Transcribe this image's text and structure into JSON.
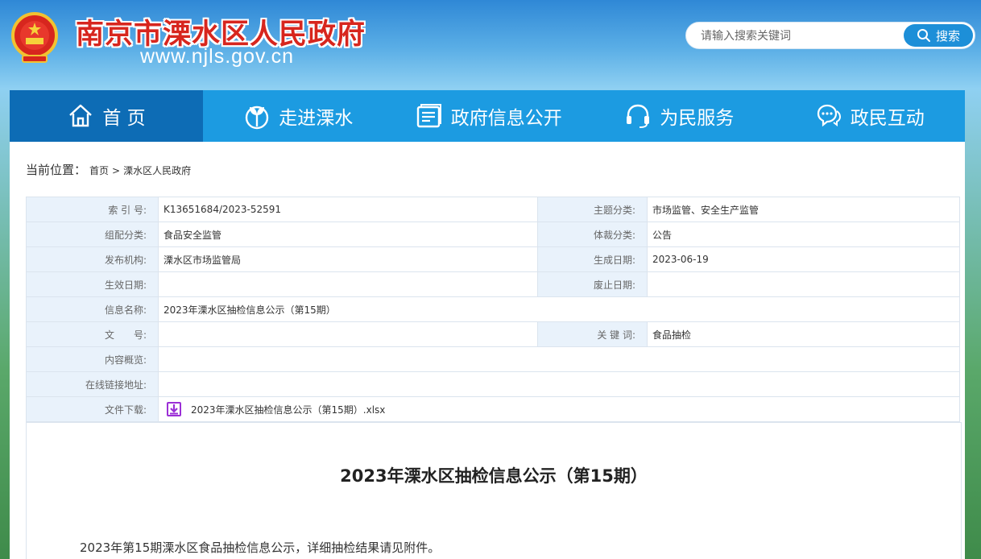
{
  "header": {
    "site_title": "南京市溧水区人民政府",
    "site_url": "www.njls.gov.cn",
    "search_placeholder": "请输入搜索关键词",
    "search_button": "搜索"
  },
  "nav": {
    "items": [
      {
        "label": "首 页",
        "icon": "home-icon"
      },
      {
        "label": "走进溧水",
        "icon": "sprout-icon"
      },
      {
        "label": "政府信息公开",
        "icon": "document-icon"
      },
      {
        "label": "为民服务",
        "icon": "headset-icon"
      },
      {
        "label": "政民互动",
        "icon": "chat-icon"
      }
    ]
  },
  "breadcrumb": {
    "label": "当前位置：",
    "home": "首页",
    "separator": ">",
    "current": "溧水区人民政府"
  },
  "meta": {
    "index_no_label": "索 引 号:",
    "index_no": "K13651684/2023-52591",
    "topic_label": "主题分类:",
    "topic": "市场监管、安全生产监管",
    "org_category_label": "组配分类:",
    "org_category": "食品安全监管",
    "genre_label": "体裁分类:",
    "genre": "公告",
    "publisher_label": "发布机构:",
    "publisher": "溧水区市场监管局",
    "created_label": "生成日期:",
    "created": "2023-06-19",
    "effective_label": "生效日期:",
    "effective": "",
    "expiry_label": "废止日期:",
    "expiry": "",
    "name_label": "信息名称:",
    "name": "2023年溧水区抽检信息公示（第15期）",
    "doc_no_label": "文　　号:",
    "doc_no": "",
    "keywords_label": "关 键 词:",
    "keywords": "食品抽检",
    "overview_label": "内容概览:",
    "overview": "",
    "link_label": "在线链接地址:",
    "link": "",
    "download_label": "文件下载:",
    "download_file": "2023年溧水区抽检信息公示（第15期）.xlsx"
  },
  "article": {
    "title": "2023年溧水区抽检信息公示（第15期）",
    "body": "2023年第15期溧水区食品抽检信息公示，详细抽检结果请见附件。"
  },
  "colors": {
    "nav_bg": "#1c9be1",
    "nav_active": "#0d6cb5",
    "title_red": "#d7261e",
    "label_bg": "#e9f2fb"
  }
}
